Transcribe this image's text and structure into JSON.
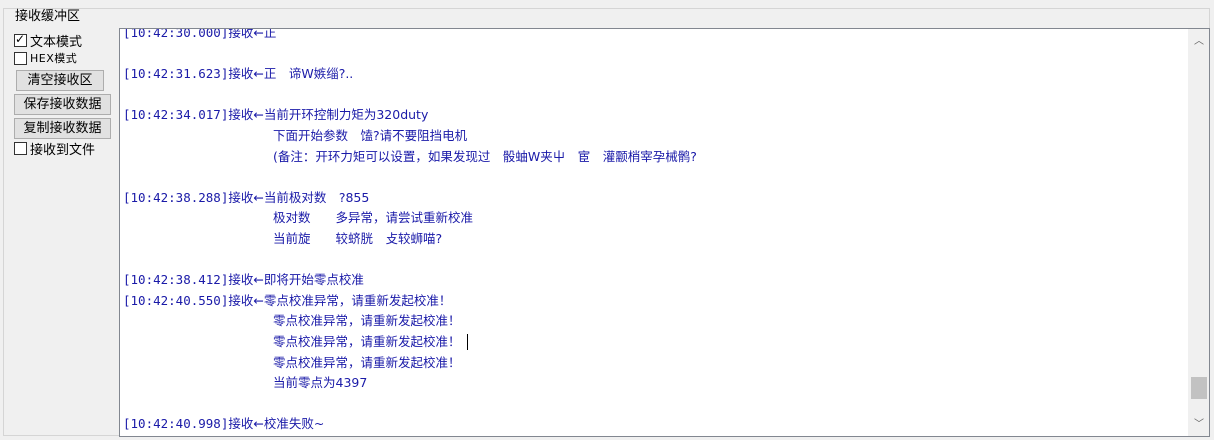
{
  "group": {
    "title": "接收缓冲区"
  },
  "options": {
    "text_mode": {
      "label": "文本模式",
      "checked": true
    },
    "hex_mode": {
      "label": "HEX模式",
      "checked": false
    },
    "receive_to_file": {
      "label": "接收到文件",
      "checked": false
    }
  },
  "buttons": {
    "clear": "清空接收区",
    "save": "保存接收数据",
    "copy": "复制接收数据"
  },
  "log": {
    "lines": [
      {
        "ts": "[10:42:30.000]",
        "msg": "接收←正"
      },
      {
        "ts": "",
        "msg": ""
      },
      {
        "ts": "[10:42:31.623]",
        "msg": "接收←正　谛W嫉缁?.."
      },
      {
        "ts": "",
        "msg": ""
      },
      {
        "ts": "[10:42:34.017]",
        "msg": "接收←当前开环控制力矩为320duty"
      },
      {
        "ts": "",
        "msg": "下面开始参数　馌?请不要阻挡电机",
        "cont": true
      },
      {
        "ts": "",
        "msg": "(备注：开环力矩可以设置，如果发现过　骰蚰W夹屮　宦　灌颥梢宰孕械鹘?",
        "cont": true
      },
      {
        "ts": "",
        "msg": ""
      },
      {
        "ts": "[10:42:38.288]",
        "msg": "接收←当前极对数　?855"
      },
      {
        "ts": "",
        "msg": "极对数　　多异常，请尝试重新校准",
        "cont": true
      },
      {
        "ts": "",
        "msg": "当前旋　　较蛴胱　攴较蛳喵?",
        "cont": true
      },
      {
        "ts": "",
        "msg": ""
      },
      {
        "ts": "[10:42:38.412]",
        "msg": "接收←即将开始零点校准"
      },
      {
        "ts": "[10:42:40.550]",
        "msg": "接收←零点校准异常，请重新发起校准！"
      },
      {
        "ts": "",
        "msg": "零点校准异常，请重新发起校准！",
        "cont": true
      },
      {
        "ts": "",
        "msg": "零点校准异常，请重新发起校准！",
        "cont": true,
        "caret": true
      },
      {
        "ts": "",
        "msg": "零点校准异常，请重新发起校准！",
        "cont": true
      },
      {
        "ts": "",
        "msg": "当前零点为4397",
        "cont": true
      },
      {
        "ts": "",
        "msg": ""
      },
      {
        "ts": "[10:42:40.998]",
        "msg": "接收←校准失败~"
      }
    ]
  },
  "scrollbar": {
    "up_icon": "up-arrow-icon",
    "down_icon": "down-arrow-icon",
    "position": 0.95
  }
}
